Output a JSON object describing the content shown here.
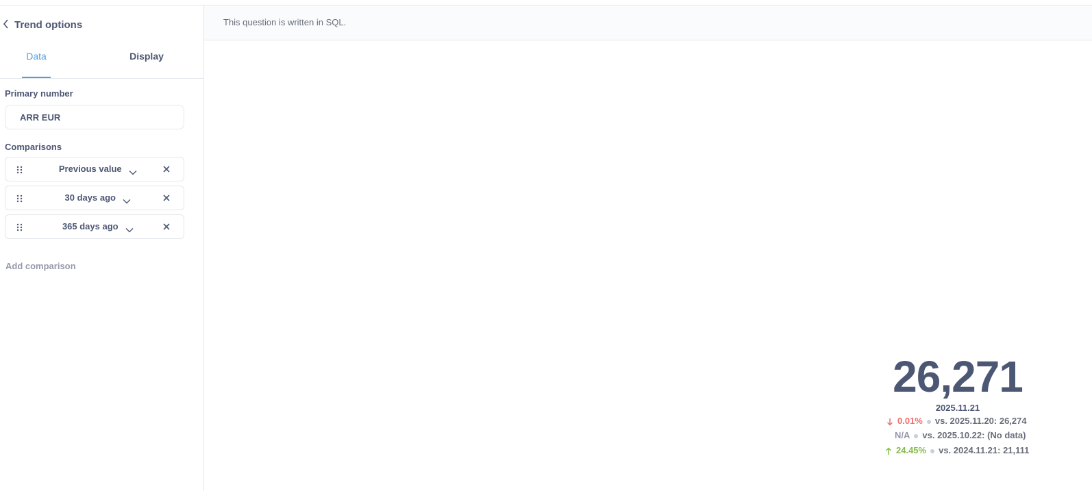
{
  "sidebar": {
    "title": "Trend options",
    "tabs": [
      {
        "label": "Data",
        "active": true
      },
      {
        "label": "Display",
        "active": false
      }
    ],
    "primary_number": {
      "label": "Primary number",
      "value": "ARR EUR"
    },
    "comparisons": {
      "label": "Comparisons",
      "items": [
        {
          "label": "Previous value"
        },
        {
          "label": "30 days ago"
        },
        {
          "label": "365 days ago"
        }
      ],
      "add_label": "Add comparison"
    }
  },
  "banner": {
    "message": "This question is written in SQL."
  },
  "trend": {
    "value": "26,271",
    "date": "2025.11.21",
    "comparisons": [
      {
        "change": "0.01%",
        "direction": "down",
        "text": "vs. 2025.11.20: 26,274"
      },
      {
        "change": "N/A",
        "direction": "none",
        "text": "vs. 2025.10.22: (No data)"
      },
      {
        "change": "24.45%",
        "direction": "up",
        "text": "vs. 2024.11.21: 21,111"
      }
    ]
  },
  "colors": {
    "accent": "#509ee3",
    "text": "#4c5773",
    "down": "#ed6e6e",
    "up": "#84bb4c",
    "muted": "#949aab"
  }
}
